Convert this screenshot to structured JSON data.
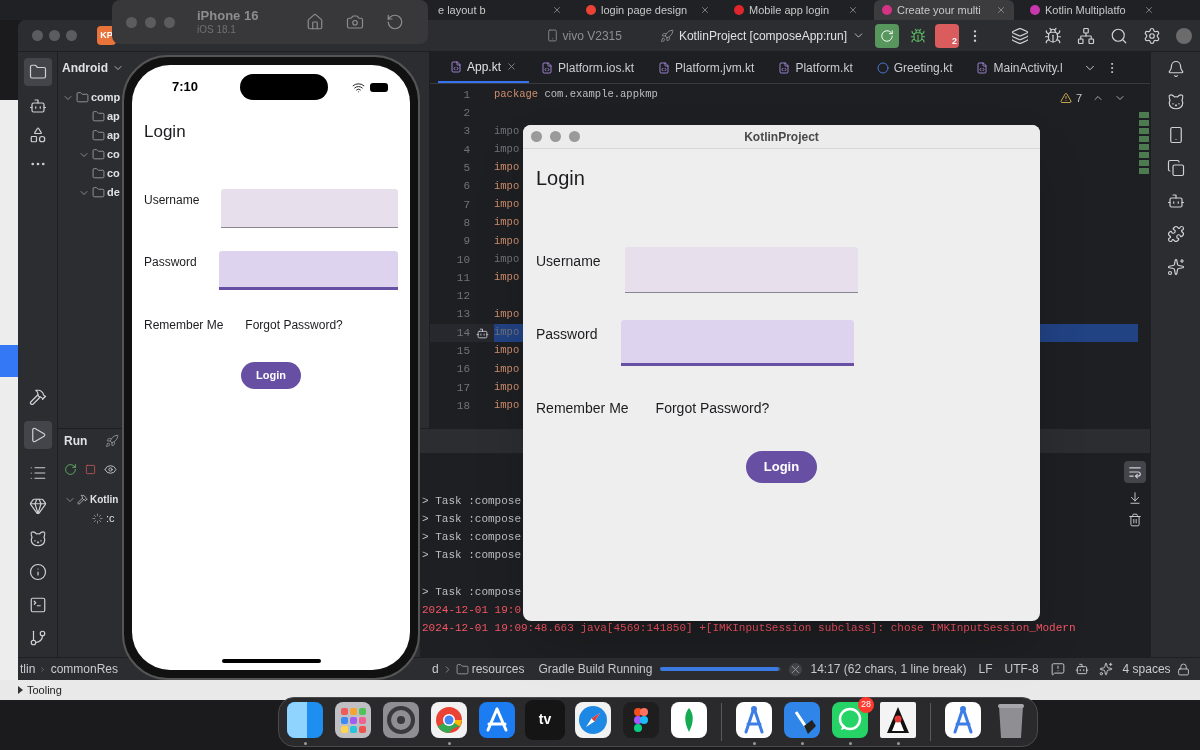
{
  "browser_tabs": [
    {
      "title": "e layout b",
      "selected": false
    },
    {
      "title": "login page design",
      "color": "#ea4335",
      "selected": false
    },
    {
      "title": "Mobile app login",
      "color": "#e0262d",
      "selected": false
    },
    {
      "title": "Create your multi",
      "color": "#d63384",
      "selected": true
    },
    {
      "title": "Kotlin Multiplatfo",
      "color": "#c837ab",
      "selected": false
    }
  ],
  "simulator": {
    "device": "iPhone 16",
    "os": "iOS 18.1"
  },
  "ide": {
    "project_badge": "KP",
    "device": "vivo V2315",
    "run_configuration": "KotlinProject [composeApp:run]",
    "device_count": "2",
    "project_view": "Android",
    "tree": [
      {
        "label": "comp",
        "expanded": true,
        "children": [
          {
            "label": "ap"
          },
          {
            "label": "ap"
          },
          {
            "label": "co",
            "expanded": true
          },
          {
            "label": "co"
          },
          {
            "label": "de",
            "expanded": true
          }
        ]
      }
    ],
    "editor_tabs": [
      {
        "label": "App.kt",
        "kind": "kotlin",
        "selected": true
      },
      {
        "label": "Platform.ios.kt",
        "kind": "kotlin",
        "selected": false
      },
      {
        "label": "Platform.jvm.kt",
        "kind": "kotlin",
        "selected": false
      },
      {
        "label": "Platform.kt",
        "kind": "kotlin",
        "selected": false
      },
      {
        "label": "Greeting.kt",
        "kind": "class",
        "selected": false
      },
      {
        "label": "MainActivity.l",
        "kind": "kotlin",
        "selected": false
      }
    ],
    "warnings": "7",
    "code_lines": [
      {
        "number": "1",
        "keyword": "package",
        "text": "com.example.appkmp",
        "selected": false
      },
      {
        "number": "2",
        "selected": false
      },
      {
        "number": "3",
        "keyword": "impo",
        "unused": true,
        "selected": false
      },
      {
        "number": "4",
        "keyword": "impo",
        "unused": true,
        "selected": false
      },
      {
        "number": "5",
        "keyword": "impo",
        "unused": false,
        "selected": false
      },
      {
        "number": "6",
        "keyword": "impo",
        "unused": false,
        "selected": false
      },
      {
        "number": "7",
        "keyword": "impo",
        "unused": false,
        "selected": false
      },
      {
        "number": "8",
        "keyword": "impo",
        "unused": false,
        "selected": false
      },
      {
        "number": "9",
        "keyword": "impo",
        "unused": false,
        "selected": false
      },
      {
        "number": "10",
        "keyword": "impo",
        "unused": true,
        "selected": false
      },
      {
        "number": "11",
        "keyword": "impo",
        "unused": false,
        "selected": false
      },
      {
        "number": "12",
        "selected": false
      },
      {
        "number": "13",
        "keyword": "impo",
        "unused": false,
        "selected": false
      },
      {
        "number": "14",
        "keyword": "impo",
        "unused": true,
        "selected": true
      },
      {
        "number": "15",
        "keyword": "impo",
        "unused": false,
        "selected": false
      },
      {
        "number": "16",
        "keyword": "impo",
        "unused": false,
        "selected": false
      },
      {
        "number": "17",
        "keyword": "impo",
        "unused": false,
        "selected": false
      },
      {
        "number": "18",
        "keyword": "impo",
        "unused": false,
        "selected": false
      }
    ],
    "run_panel": {
      "title": "Run",
      "tree": [
        {
          "label": "Kotlin",
          "expanded": true,
          "children": [
            {
              "label": ":c",
              "running": true
            }
          ]
        }
      ],
      "console": [
        {
          "kind": "output",
          "text": "> Task :compose"
        },
        {
          "kind": "output",
          "text": "> Task :compose"
        },
        {
          "kind": "output",
          "text": "> Task :compose"
        },
        {
          "kind": "output",
          "text": "> Task :compose"
        },
        {
          "kind": "blank"
        },
        {
          "kind": "output",
          "text": "> Task :compose"
        },
        {
          "kind": "error",
          "text": "2024-12-01 19:0"
        },
        {
          "kind": "error",
          "text": "2024-12-01 19:09:48.663 java[4569:141850] +[IMKInputSession subclass]: chose IMKInputSession_Modern"
        }
      ]
    },
    "status_bar": {
      "path": [
        "tlin",
        "commonRes"
      ],
      "path_tail": [
        "d",
        "resources"
      ],
      "task": "Gradle Build Running",
      "level": 0.98,
      "position": "14:17 (62 chars, 1 line break)",
      "line_separator": "LF",
      "encoding": "UTF-8",
      "indent": "4 spaces"
    }
  },
  "below_ide": {
    "label": "Tooling"
  },
  "phone": {
    "time": "7:10",
    "app": {
      "title": "Login",
      "fields": [
        {
          "label": "Username",
          "focused": false
        },
        {
          "label": "Password",
          "focused": true
        }
      ],
      "remember": "Remember Me",
      "forgot": "Forgot Password?",
      "button": "Login"
    }
  },
  "desktop_window": {
    "title": "KotlinProject",
    "form": {
      "title": "Login",
      "fields": [
        {
          "label": "Username",
          "focused": false
        },
        {
          "label": "Password",
          "focused": true
        }
      ],
      "remember": "Remember Me",
      "forgot": "Forgot Password?",
      "button": "Login"
    }
  },
  "dock": {
    "sections": [
      {
        "items": [
          {
            "kind": "finder",
            "running": true
          },
          {
            "kind": "launchpad",
            "running": false
          },
          {
            "kind": "settings",
            "running": false
          },
          {
            "kind": "chrome",
            "running": true
          },
          {
            "kind": "appstore",
            "running": false
          },
          {
            "kind": "tv",
            "label": "tv",
            "running": false
          },
          {
            "kind": "safari",
            "running": false
          },
          {
            "kind": "figma",
            "running": false
          },
          {
            "kind": "mongodb",
            "running": false
          }
        ]
      },
      {
        "items": [
          {
            "kind": "studio",
            "running": true
          },
          {
            "kind": "xcode",
            "running": true
          },
          {
            "kind": "whatsapp",
            "badge": "28",
            "running": true
          },
          {
            "kind": "duke",
            "running": true
          }
        ]
      },
      {
        "items": [
          {
            "kind": "studio",
            "running": false
          },
          {
            "kind": "trash",
            "running": false
          }
        ]
      }
    ]
  }
}
